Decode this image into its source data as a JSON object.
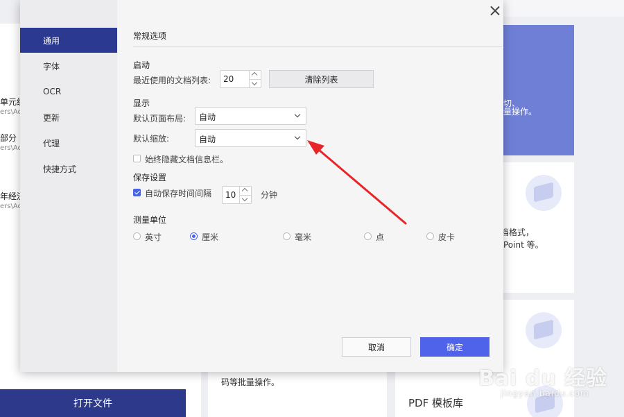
{
  "background": {
    "left_items": [
      {
        "title": "单元统",
        "path": "ers\\Ac"
      },
      {
        "title": "部分 ：",
        "path": "ers\\Ac"
      },
      {
        "title": "年经济",
        "path": "ers\\Ac"
      }
    ],
    "open_file_label": "打开文件",
    "card1_line1": "切、",
    "card1_line2": "量操作。",
    "card2_line1": "档格式，",
    "card2_line2": "Point 等。",
    "card_bottom_text": "码等批量操作。",
    "template_label": "PDF 模板库"
  },
  "dialog": {
    "sidebar": [
      {
        "label": "通用",
        "active": true
      },
      {
        "label": "字体",
        "active": false
      },
      {
        "label": "OCR",
        "active": false
      },
      {
        "label": "更新",
        "active": false
      },
      {
        "label": "代理",
        "active": false
      },
      {
        "label": "快捷方式",
        "active": false
      }
    ],
    "title": "常规选项",
    "startup": {
      "heading": "启动",
      "recent_label": "最近使用的文档列表:",
      "recent_value": "20",
      "clear_label": "清除列表"
    },
    "display": {
      "heading": "显示",
      "layout_label": "默认页面布局:",
      "layout_value": "自动",
      "zoom_label": "默认缩放:",
      "zoom_value": "自动",
      "hide_info_label": "始终隐藏文档信息栏。",
      "hide_info_checked": false
    },
    "save": {
      "heading": "保存设置",
      "autosave_label": "自动保存时间间隔",
      "autosave_checked": true,
      "interval_value": "10",
      "unit": "分钟"
    },
    "measure": {
      "heading": "测量单位",
      "options": [
        {
          "label": "英寸",
          "selected": false
        },
        {
          "label": "厘米",
          "selected": true
        },
        {
          "label": "毫米",
          "selected": false
        },
        {
          "label": "点",
          "selected": false
        },
        {
          "label": "皮卡",
          "selected": false
        }
      ]
    },
    "cancel_label": "取消",
    "ok_label": "确定"
  },
  "watermark": {
    "brand": "Bai du 经验",
    "url": "jingyan.baidu.com"
  },
  "colors": {
    "accent": "#4e63ea",
    "sidebar_active": "#2b3990",
    "arrow": "#e8262a"
  }
}
